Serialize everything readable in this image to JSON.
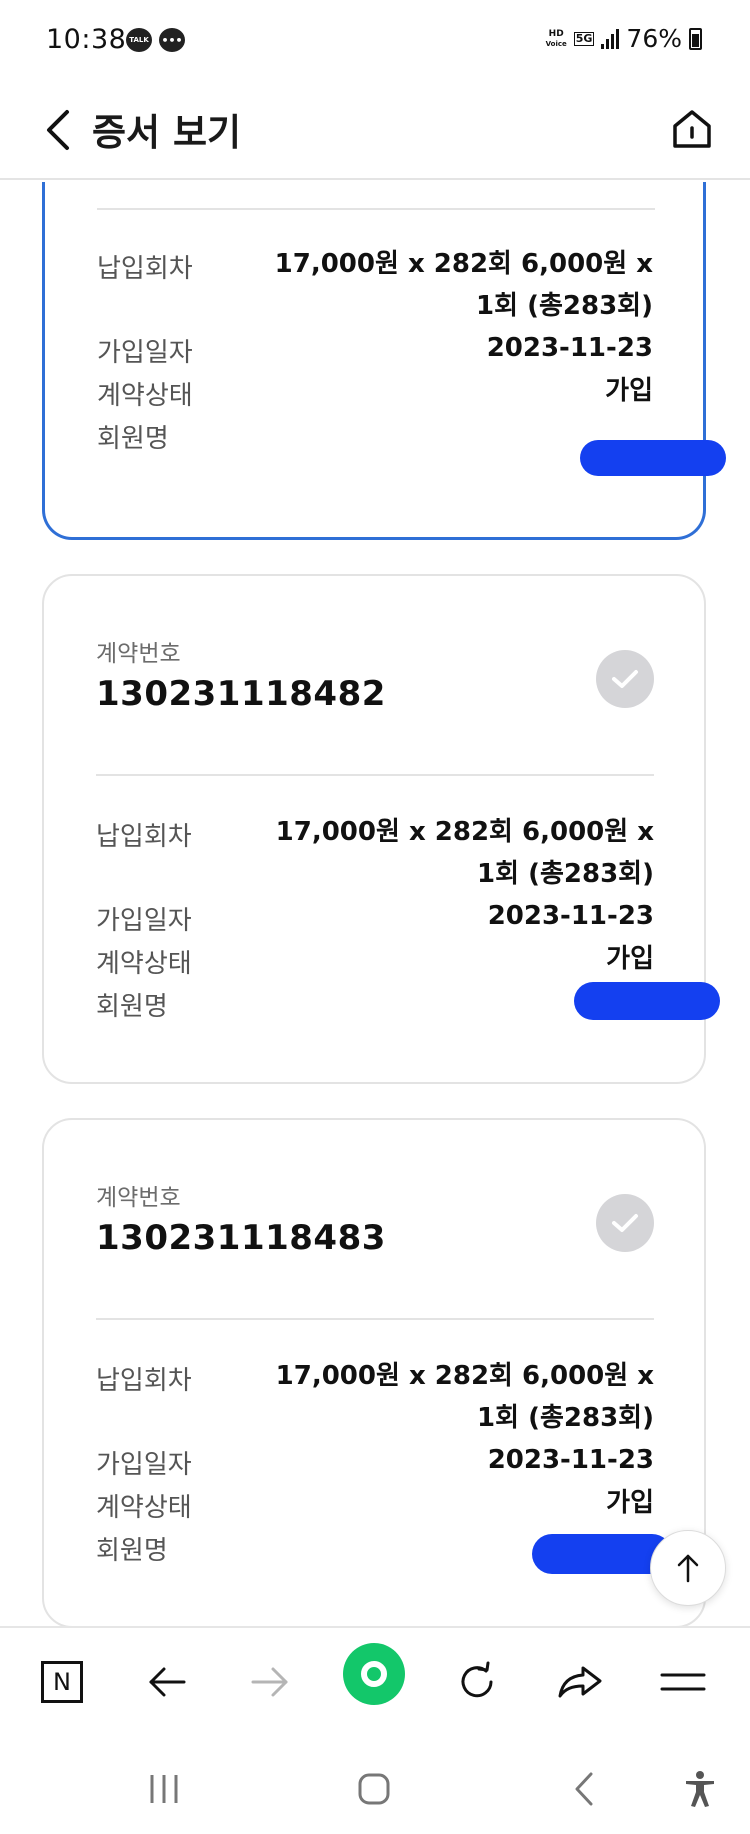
{
  "status_bar": {
    "time": "10:38",
    "notif_icons": [
      "TALK",
      "•••"
    ],
    "hd_voice_top": "HD",
    "hd_voice_bottom": "Voice",
    "network": "5G",
    "battery": "76%"
  },
  "header": {
    "title": "증서 보기",
    "back_icon": "chevron-left-icon",
    "home_icon": "home-icon"
  },
  "cards": [
    {
      "rows": [
        {
          "label": "납입회차",
          "value_line1": "17,000원 x 282회 6,000원 x",
          "value_line2": "1회 (총283회)"
        },
        {
          "label": "가입일자",
          "value": "2023-11-23"
        },
        {
          "label": "계약상태",
          "value": "가입"
        },
        {
          "label": "회원명",
          "value": ""
        }
      ],
      "selected": true
    },
    {
      "contract_label": "계약번호",
      "contract_number": "130231118482",
      "rows": [
        {
          "label": "납입회차",
          "value_line1": "17,000원 x 282회 6,000원 x",
          "value_line2": "1회 (총283회)"
        },
        {
          "label": "가입일자",
          "value": "2023-11-23"
        },
        {
          "label": "계약상태",
          "value": "가입"
        },
        {
          "label": "회원명",
          "value": ""
        }
      ],
      "selected": false
    },
    {
      "contract_label": "계약번호",
      "contract_number": "130231118483",
      "rows": [
        {
          "label": "납입회차",
          "value_line1": "17,000원 x 282회 6,000원 x",
          "value_line2": "1회 (총283회)"
        },
        {
          "label": "가입일자",
          "value": "2023-11-23"
        },
        {
          "label": "계약상태",
          "value": "가입"
        },
        {
          "label": "회원명",
          "value": ""
        }
      ],
      "selected": false
    }
  ],
  "toolbar": {
    "naver_label": "N",
    "icons": [
      "naver-icon",
      "arrow-left-icon",
      "arrow-right-icon",
      "green-dot-icon",
      "refresh-icon",
      "share-icon",
      "menu-icon"
    ]
  },
  "android_nav": {
    "icons": [
      "recents-icon",
      "home-icon",
      "back-icon",
      "accessibility-icon"
    ]
  },
  "colors": {
    "accent_blue": "#2f6fd6",
    "redaction_blue": "#1440f0",
    "green": "#13c76a",
    "check_grey": "#d5d5d8"
  }
}
